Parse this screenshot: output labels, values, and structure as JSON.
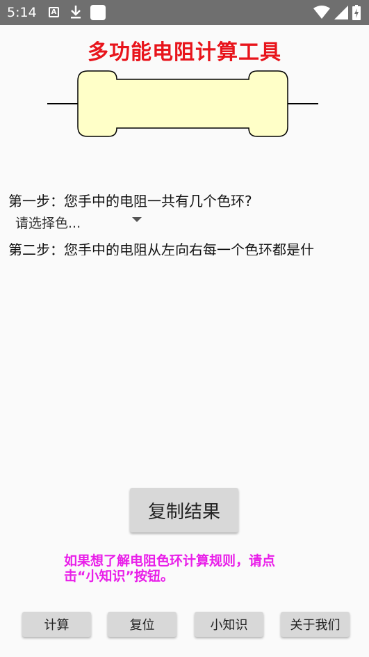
{
  "status_bar": {
    "time": "5:14",
    "icons": [
      "a-notification-icon",
      "download-icon",
      "app-square-icon",
      "wifi-icon",
      "signal-icon",
      "battery-icon"
    ]
  },
  "app": {
    "title": "多功能电阻计算工具"
  },
  "steps": {
    "step1": "第一步：您手中的电阻一共有几个色环?",
    "spinner_value": "请选择色...",
    "step2": "第二步：您手中的电阻从左向右每一个色环都是什"
  },
  "actions": {
    "copy_result": "复制结果",
    "hint": "如果想了解电阻色环计算规则，请点击“小知识”按钮。"
  },
  "bottom_bar": {
    "calculate": "计算",
    "reset": "复位",
    "tips": "小知识",
    "about": "关于我们"
  },
  "colors": {
    "title": "#e8141b",
    "hint": "#e91ee9",
    "resistor_body": "#ffffc8",
    "status_bar": "#6f6f6f"
  }
}
